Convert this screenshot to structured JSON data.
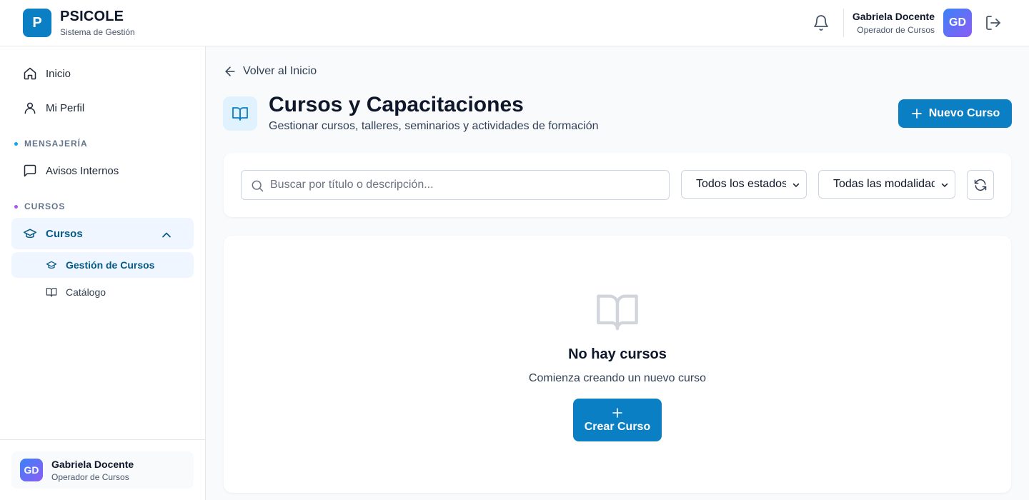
{
  "header": {
    "logo_letter": "P",
    "brand": "PSICOLE",
    "subtitle": "Sistema de Gestión",
    "user": {
      "name": "Gabriela Docente",
      "role": "Operador de Cursos",
      "initials": "GD"
    }
  },
  "sidebar": {
    "items": [
      {
        "label": "Inicio",
        "icon": "home-icon"
      },
      {
        "label": "Mi Perfil",
        "icon": "user-icon"
      }
    ],
    "sections": [
      {
        "title": "MENSAJERÍA",
        "color": "#0ea5e9",
        "items": [
          {
            "label": "Avisos Internos",
            "icon": "message-icon"
          }
        ]
      },
      {
        "title": "CURSOS",
        "color": "#a855f7",
        "items": [
          {
            "label": "Cursos",
            "icon": "graduation-cap-icon",
            "expanded": true,
            "children": [
              {
                "label": "Gestión de Cursos",
                "icon": "graduation-cap-icon",
                "active": true
              },
              {
                "label": "Catálogo",
                "icon": "book-open-icon"
              }
            ]
          }
        ]
      }
    ],
    "footer_user": {
      "name": "Gabriela Docente",
      "role": "Operador de Cursos",
      "initials": "GD"
    }
  },
  "main": {
    "back_link": "Volver al Inicio",
    "title": "Cursos y Capacitaciones",
    "subtitle": "Gestionar cursos, talleres, seminarios y actividades de formación",
    "new_button": "Nuevo Curso",
    "filters": {
      "search_placeholder": "Buscar por título o descripción...",
      "search_value": "",
      "status_selected": "Todos los estados",
      "modality_selected": "Todas las modalidades"
    },
    "empty": {
      "title": "No hay cursos",
      "subtitle": "Comienza creando un nuevo curso",
      "button": "Crear Curso"
    }
  },
  "colors": {
    "primary": "#0b7fc4",
    "active_bg": "#eff6ff",
    "active_text": "#075985"
  }
}
